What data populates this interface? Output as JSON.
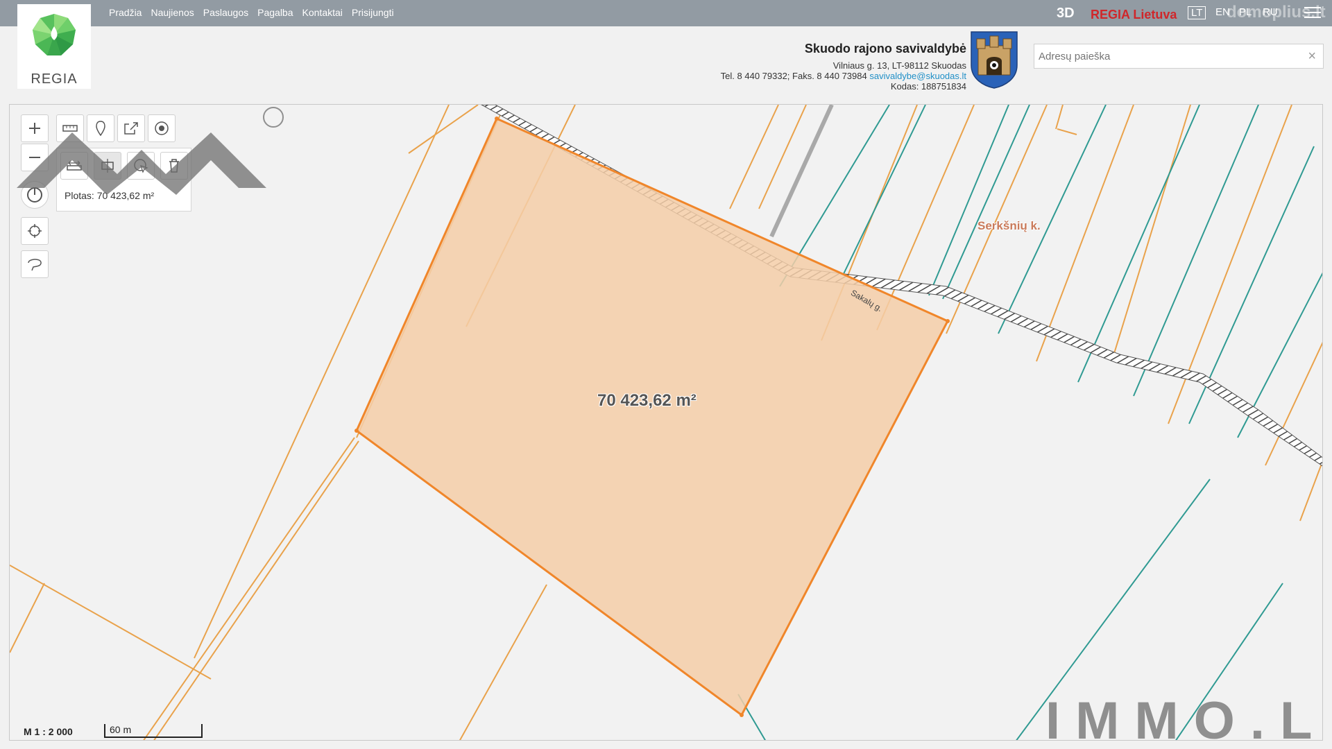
{
  "logo": {
    "text": "REGIA"
  },
  "nav": [
    "Pradžia",
    "Naujienos",
    "Paslaugos",
    "Pagalba",
    "Kontaktai",
    "Prisijungti"
  ],
  "top_right": {
    "btn_3d": "3D",
    "regia_lietuva": "REGIA Lietuva",
    "lang_lt": "LT",
    "lang_en": "EN",
    "lang_pl": "PL",
    "lang_ru": "RU",
    "watermark": "domoplius.lt"
  },
  "municipality": {
    "name": "Skuodo rajono savivaldybė",
    "address": "Vilniaus g. 13, LT-98112 Skuodas",
    "phone": "Tel. 8 440 79332; Faks. 8 440 73984",
    "email": "savivaldybe@skuodas.lt",
    "code": "Kodas: 188751834"
  },
  "search": {
    "placeholder": "Adresų paieška",
    "clear": "×"
  },
  "map": {
    "measure_result": "Plotas: 70 423,62 m²",
    "area_label": "70 423,62 m²",
    "place_name": "Serkšnių k.",
    "street_name": "Sakalų g.",
    "scale_ratio": "M 1 : 2 000",
    "scale_bar": "60 m",
    "watermark_brand": "IMMO.LT"
  },
  "icons": [
    "zoom-in-icon",
    "zoom-out-icon",
    "ruler-icon",
    "pin-icon",
    "share-icon",
    "target-icon",
    "measure-distance-icon",
    "measure-area-icon",
    "select-icon",
    "trash-icon",
    "compass-icon",
    "locate-icon",
    "lasso-icon"
  ],
  "colors": {
    "topbar": "#929ba3",
    "parcel_fill": "#f5cea8",
    "parcel_stroke": "#f0862a",
    "parcel_line": "#e9a24b",
    "teal_line": "#2f9a92",
    "regia_red": "#d0262a"
  }
}
